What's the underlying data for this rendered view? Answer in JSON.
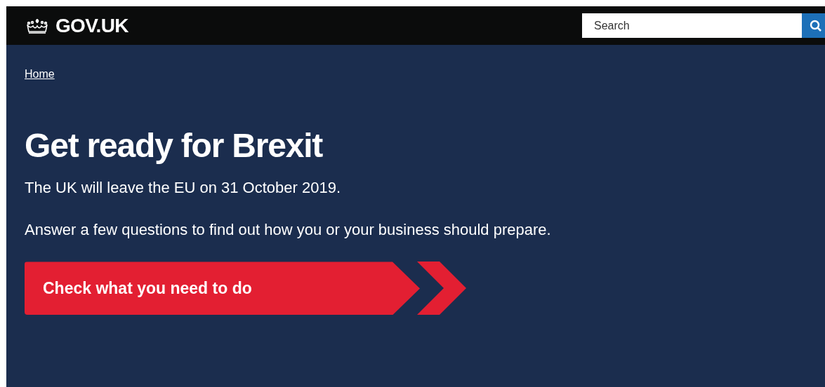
{
  "header": {
    "logo": "GOV.UK",
    "search": {
      "placeholder": "Search"
    }
  },
  "breadcrumb": [
    "Home"
  ],
  "title": "Get ready for Brexit",
  "paragraphs": [
    "The UK will leave the EU on 31 October 2019.",
    "Answer a few questions to find out how you or your business should prepare."
  ],
  "cta": "Check what you need to do"
}
